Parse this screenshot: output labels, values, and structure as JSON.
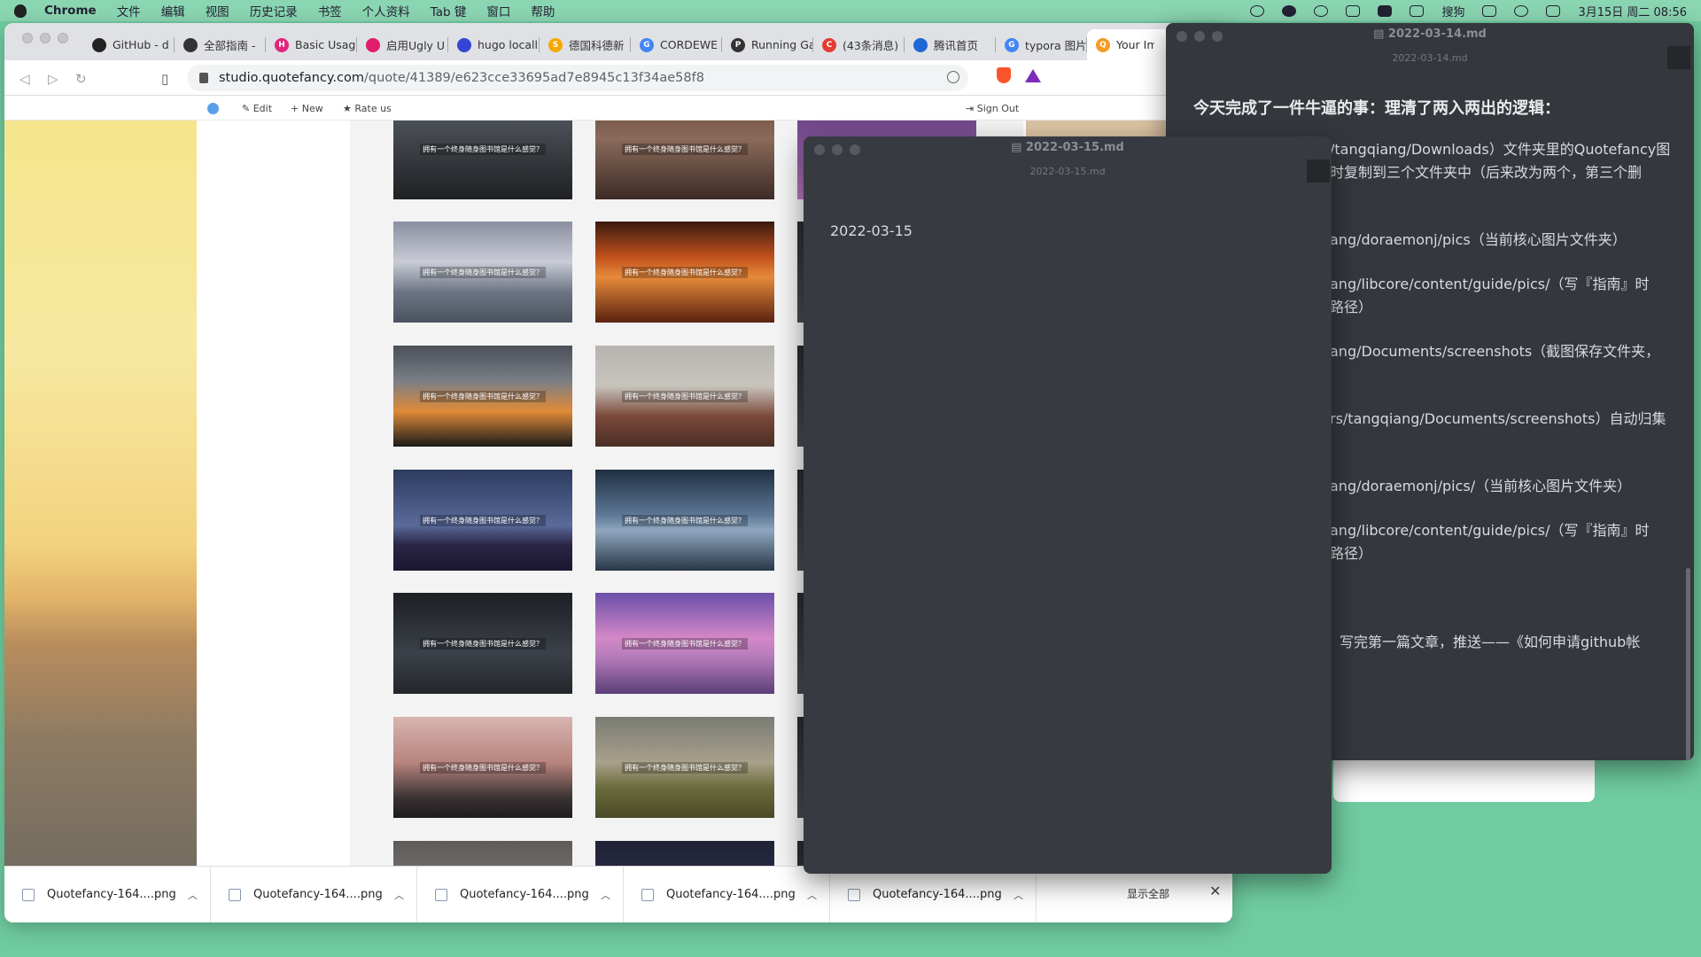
{
  "menubar": {
    "app": "Chrome",
    "menus": [
      "文件",
      "编辑",
      "视图",
      "历史记录",
      "书签",
      "个人资料",
      "Tab 键",
      "窗口",
      "帮助"
    ],
    "status": {
      "ime": "搜狗",
      "datetime": "3月15日 周二  08:56"
    }
  },
  "browser": {
    "tabs": [
      {
        "title": "GitHub - d",
        "icon": "github-icon",
        "color": "#222222",
        "glyph": ""
      },
      {
        "title": "全部指南 - ",
        "icon": "globe-icon",
        "color": "#333333",
        "glyph": ""
      },
      {
        "title": "Basic Usag",
        "icon": "hugo-icon",
        "color": "#e0267d",
        "glyph": "H"
      },
      {
        "title": "启用Ugly U",
        "icon": "site-icon",
        "color": "#e01d6a",
        "glyph": ""
      },
      {
        "title": "hugo locall",
        "icon": "baidu-icon",
        "color": "#3445d6",
        "glyph": ""
      },
      {
        "title": "德国科德新",
        "icon": "s-icon",
        "color": "#f5a800",
        "glyph": "S"
      },
      {
        "title": "CORDEWE",
        "icon": "google-icon",
        "color": "#4285f4",
        "glyph": "G"
      },
      {
        "title": "Running Ga",
        "icon": "p-icon",
        "color": "#333333",
        "glyph": "P"
      },
      {
        "title": "(43条消息)",
        "icon": "csdn-icon",
        "color": "#e33e33",
        "glyph": "C"
      },
      {
        "title": "腾讯首页",
        "icon": "tencent-icon",
        "color": "#2067d6",
        "glyph": ""
      },
      {
        "title": "typora 图片",
        "icon": "google-icon",
        "color": "#4285f4",
        "glyph": "G"
      },
      {
        "title": "Your Im",
        "icon": "quotefancy-icon",
        "color": "#f59a23",
        "glyph": "Q",
        "active": true
      }
    ],
    "url_domain": "studio.quotefancy.com",
    "url_path": "/quote/41389/e623cce33695ad7e8945c13f34ae58f8",
    "site_nav": {
      "edit": "Edit",
      "new": "New",
      "rate": "Rate us",
      "signout": "Sign Out"
    }
  },
  "gallery": {
    "caption": "拥有一个终身随身图书馆是什么感觉？",
    "thumbnails": [
      {
        "bg": "linear-gradient(180deg,#5a6068,#2f3236 70%,#1f2124)"
      },
      {
        "bg": "linear-gradient(180deg,#6b4a3a,#8a6a5a 40%,#3d2b25)"
      },
      {
        "bg": "linear-gradient(180deg,#8a8fa0,#c9ccd6 40%,#6c7382 70%,#4b525f)"
      },
      {
        "bg": "linear-gradient(180deg,#3a1a10,#c0501c 35%,#e68a3a 55%,#5a2210)"
      },
      {
        "bg": "linear-gradient(180deg,#4a4f58,#7a7f86 35%,#e08a38 65%,#1c1a1a)"
      },
      {
        "bg": "linear-gradient(180deg,#b7b4b0,#c8c3bd 40%,#7b4a3a 70%,#4a2d24)"
      },
      {
        "bg": "linear-gradient(180deg,#2c3b5e,#5a6a9a 55%,#2a2545 75%,#1a1730)"
      },
      {
        "bg": "linear-gradient(180deg,#1f2f42,#5d7896 45%,#8fa7bf 60%,#283646)"
      },
      {
        "bg": "linear-gradient(180deg,#1c1f24,#3c4149 60%,#23262b)"
      },
      {
        "bg": "linear-gradient(180deg,#6b4fa8,#d488c8 45%,#b37ab8 65%,#5a3f78)"
      },
      {
        "bg": "linear-gradient(180deg,#d8b4b0,#b8847e 45%,#3a3233 80%,#1e1b1c)"
      },
      {
        "bg": "linear-gradient(180deg,#7a7c74,#a8a08a 45%,#6b6c3c 70%,#4a4a28)"
      },
      {
        "bg": "linear-gradient(180deg,#5e5a58,#9a9590)"
      },
      {
        "bg": "linear-gradient(180deg,#1f2236,#3a3d5a)"
      }
    ]
  },
  "downloads": {
    "items": [
      "Quotefancy-164....png",
      "Quotefancy-164....png",
      "Quotefancy-164....png",
      "Quotefancy-164....png",
      "Quotefancy-164....png"
    ],
    "show_all": "显示全部"
  },
  "editor_back": {
    "title": "2022-03-14.md",
    "subtitle": "2022-03-14.md",
    "heading": "今天完成了一件牛逼的事：理清了两入两出的逻辑：",
    "lines": [
      "/tangqiang/Downloads）文件夹里的Quotefancy图",
      "时复制到三个文件夹中（后来改为两个，第三个删",
      "ang/doraemonj/pics（当前核心图片文件夹）",
      "ang/libcore/content/guide/pics/（写『指南』时",
      "路径）",
      "ang/Documents/screenshots（截图保存文件夹，",
      "rs/tangqiang/Documents/screenshots）自动归集",
      "ang/doraemonj/pics/（当前核心图片文件夹）",
      "ang/libcore/content/guide/pics/（写『指南』时",
      "路径）",
      "写完第一篇文章，推送——《如何申请github帐"
    ]
  },
  "editor_front": {
    "title": "2022-03-15.md",
    "subtitle": "2022-03-15.md",
    "body": "2022-03-15"
  }
}
